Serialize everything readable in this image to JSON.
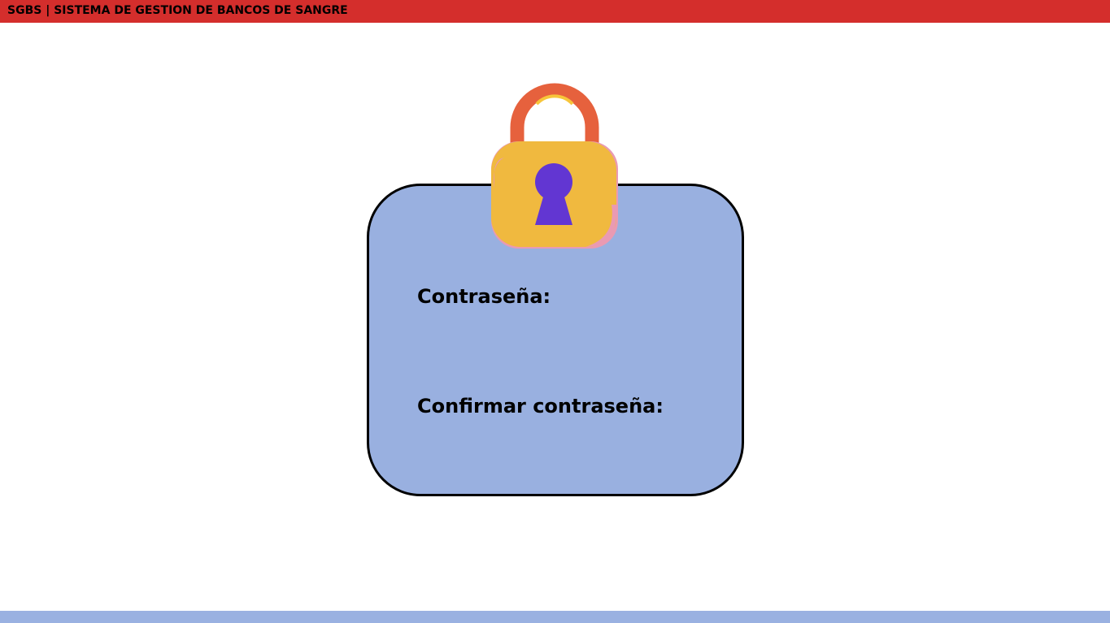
{
  "header": {
    "title": "SGBS | SISTEMA DE GESTION DE BANCOS DE SANGRE",
    "color": "#d42e2c"
  },
  "form": {
    "password_label": "Contraseña:",
    "confirm_label": "Confirmar contraseña:",
    "password_value": "",
    "confirm_value": "",
    "card_color": "#99b0e0"
  },
  "lock_icon": {
    "name": "padlock-icon",
    "shackle_color": "#e6613d",
    "body_color": "#f0b93f",
    "accent_color": "#e99ab3",
    "keyhole_color": "#6236d2"
  },
  "footer": {
    "color": "#9ab1e1"
  }
}
